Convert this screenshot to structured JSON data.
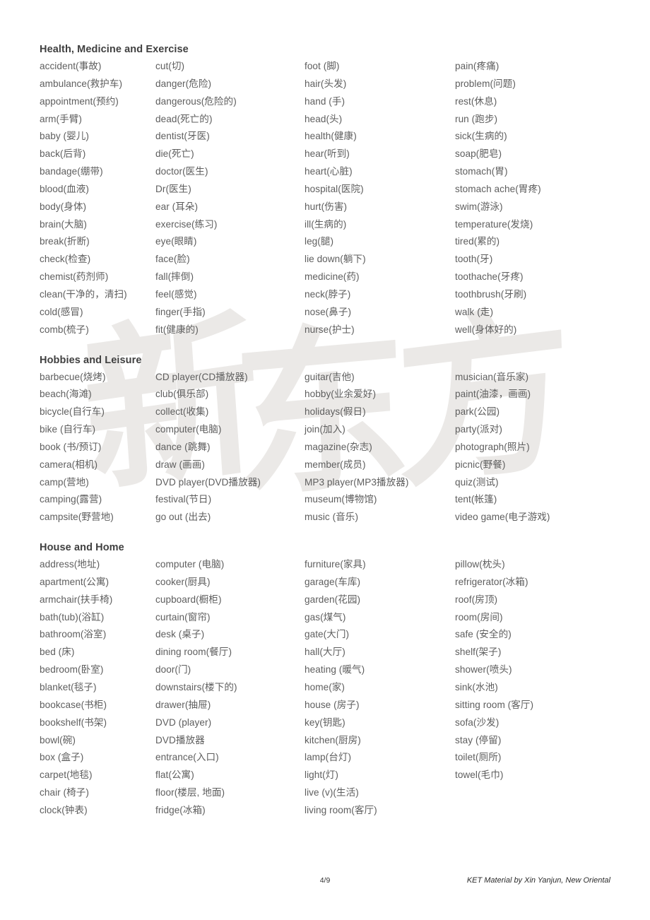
{
  "document": {
    "page_label": "4/9",
    "credit": "KET Material by Xin Yanjun, New Oriental",
    "watermark": {
      "char1": "新",
      "char2": "东",
      "char3": "方",
      "color": "#ebe9e7"
    },
    "text_color": "#5e5e5e",
    "heading_color": "#404040"
  },
  "sections": [
    {
      "title": "Health, Medicine and Exercise",
      "columns": [
        [
          "accident(事故)",
          "ambulance(救护车)",
          "appointment(预约)",
          "arm(手臂)",
          "baby (婴儿)",
          "back(后背)",
          "bandage(绷带)",
          "blood(血液)",
          "body(身体)",
          "brain(大脑)",
          "break(折断)",
          "check(检查)",
          "chemist(药剂师)",
          "clean(干净的，清扫)",
          "cold(感冒)",
          "comb(梳子)"
        ],
        [
          "cut(切)",
          "danger(危险)",
          "dangerous(危险的)",
          "dead(死亡的)",
          "dentist(牙医)",
          "die(死亡)",
          "doctor(医生)",
          "Dr(医生)",
          "ear (耳朵)",
          "exercise(练习)",
          "eye(眼睛)",
          "face(脸)",
          "fall(摔倒)",
          "feel(感觉)",
          "finger(手指)",
          "fit(健康的)"
        ],
        [
          "foot (脚)",
          "hair(头发)",
          "hand (手)",
          "head(头)",
          "health(健康)",
          "hear(听到)",
          "heart(心脏)",
          "hospital(医院)",
          "hurt(伤害)",
          "ill(生病的)",
          "leg(腿)",
          "lie down(躺下)",
          "medicine(药)",
          "neck(脖子)",
          "nose(鼻子)",
          "nurse(护士)"
        ],
        [
          "pain(疼痛)",
          "problem(问题)",
          "rest(休息)",
          "run (跑步)",
          "sick(生病的)",
          "soap(肥皂)",
          "stomach(胃)",
          "stomach ache(胃疼)",
          "swim(游泳)",
          "temperature(发烧)",
          "tired(累的)",
          "tooth(牙)",
          "toothache(牙疼)",
          "toothbrush(牙刷)",
          "walk (走)",
          "well(身体好的)"
        ]
      ]
    },
    {
      "title": "Hobbies and Leisure",
      "columns": [
        [
          "barbecue(烧烤)",
          "beach(海滩)",
          "bicycle(自行车)",
          "bike (自行车)",
          "book (书/预订)",
          "camera(相机)",
          "camp(营地)",
          "camping(露营)",
          "campsite(野营地)"
        ],
        [
          "CD player(CD播放器)",
          "club(俱乐部)",
          "collect(收集)",
          "computer(电脑)",
          "dance (跳舞)",
          "draw (画画)",
          "DVD player(DVD播放器)",
          "festival(节日)",
          "go out (出去)"
        ],
        [
          "guitar(吉他)",
          "hobby(业余爱好)",
          "holidays(假日)",
          "join(加入)",
          "magazine(杂志)",
          "member(成员)",
          "MP3 player(MP3播放器)",
          "museum(博物馆)",
          "music (音乐)"
        ],
        [
          "musician(音乐家)",
          "paint(油漆，画画)",
          "park(公园)",
          "party(派对)",
          "photograph(照片)",
          "picnic(野餐)",
          "quiz(测试)",
          "tent(帐篷)",
          "video game(电子游戏)"
        ]
      ]
    },
    {
      "title": "House and Home",
      "columns": [
        [
          "address(地址)",
          "apartment(公寓)",
          "armchair(扶手椅)",
          "bath(tub)(浴缸)",
          "bathroom(浴室)",
          "bed (床)",
          "bedroom(卧室)",
          "blanket(毯子)",
          "bookcase(书柜)",
          "bookshelf(书架)",
          "bowl(碗)",
          "box (盒子)",
          "carpet(地毯)",
          "chair (椅子)",
          "clock(钟表)"
        ],
        [
          "computer (电脑)",
          "cooker(厨具)",
          "cupboard(橱柜)",
          "curtain(窗帘)",
          "desk (桌子)",
          "dining room(餐厅)",
          "door(门)",
          "downstairs(楼下的)",
          "drawer(抽屉)",
          "DVD (player)",
          "DVD播放器",
          "entrance(入口)",
          "flat(公寓)",
          "floor(楼层, 地面)",
          "fridge(冰箱)"
        ],
        [
          "furniture(家具)",
          "garage(车库)",
          "garden(花园)",
          "gas(煤气)",
          "gate(大门)",
          "hall(大厅)",
          "heating (暖气)",
          "home(家)",
          "house (房子)",
          "key(钥匙)",
          "kitchen(厨房)",
          "lamp(台灯)",
          "light(灯)",
          "live (v)(生活)",
          "living room(客厅)"
        ],
        [
          "pillow(枕头)",
          "refrigerator(冰箱)",
          "roof(房顶)",
          "room(房间)",
          "safe (安全的)",
          "shelf(架子)",
          "shower(喷头)",
          "sink(水池)",
          "sitting room (客厅)",
          "sofa(沙发)",
          "stay (停留)",
          "toilet(厕所)",
          "towel(毛巾)"
        ]
      ]
    }
  ]
}
